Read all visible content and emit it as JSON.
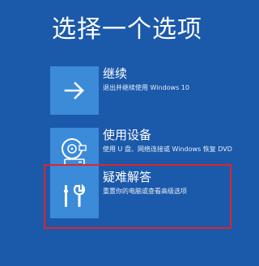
{
  "page": {
    "title": "选择一个选项"
  },
  "options": [
    {
      "title": "继续",
      "description": "退出并继续使用 Windows 10",
      "icon": "arrow-right-icon"
    },
    {
      "title": "使用设备",
      "description": "使用 U 盘、网络连接或 Windows 恢复 DVD",
      "icon": "disc-drive-icon"
    },
    {
      "title": "疑难解答",
      "description": "重置你的电脑或查看高级选项",
      "icon": "tools-icon"
    }
  ],
  "highlight": {
    "color": "#e0242b",
    "target": "options.2"
  },
  "colors": {
    "background": "#1b59aa",
    "tile": "#3b8bd8",
    "text": "#ffffff"
  }
}
